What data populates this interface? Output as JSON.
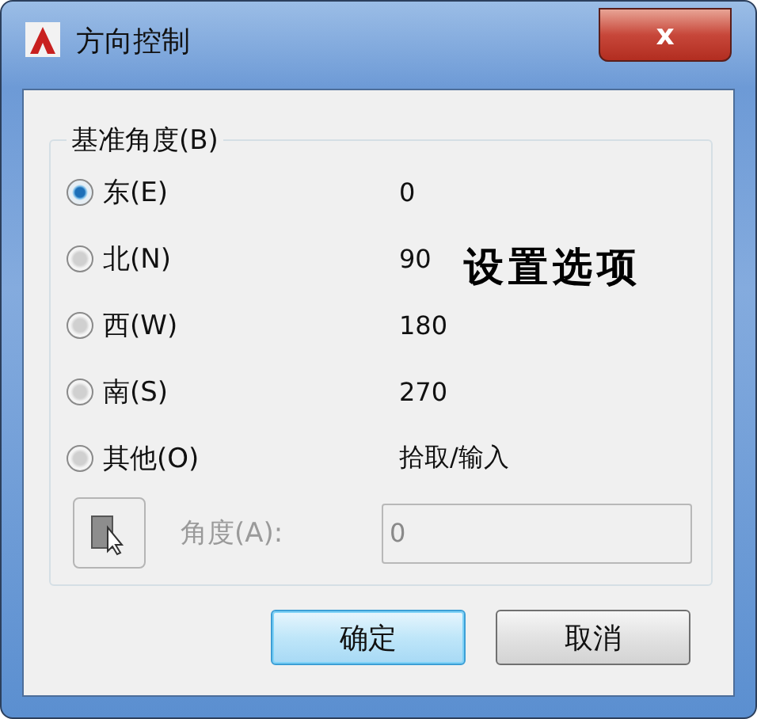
{
  "window": {
    "title": "方向控制",
    "close": "x"
  },
  "group": {
    "label": "基准角度(B)"
  },
  "options": [
    {
      "label": "东(E)",
      "value": "0",
      "selected": true
    },
    {
      "label": "北(N)",
      "value": "90",
      "selected": false
    },
    {
      "label": "西(W)",
      "value": "180",
      "selected": false
    },
    {
      "label": "南(S)",
      "value": "270",
      "selected": false
    },
    {
      "label": "其他(O)",
      "value": "拾取/输入",
      "selected": false
    }
  ],
  "annotation": "设置选项",
  "angle": {
    "label": "角度(A):",
    "value": "0",
    "disabled": true
  },
  "buttons": [
    {
      "label": "确定",
      "default": true
    },
    {
      "label": "取消",
      "default": false
    }
  ]
}
